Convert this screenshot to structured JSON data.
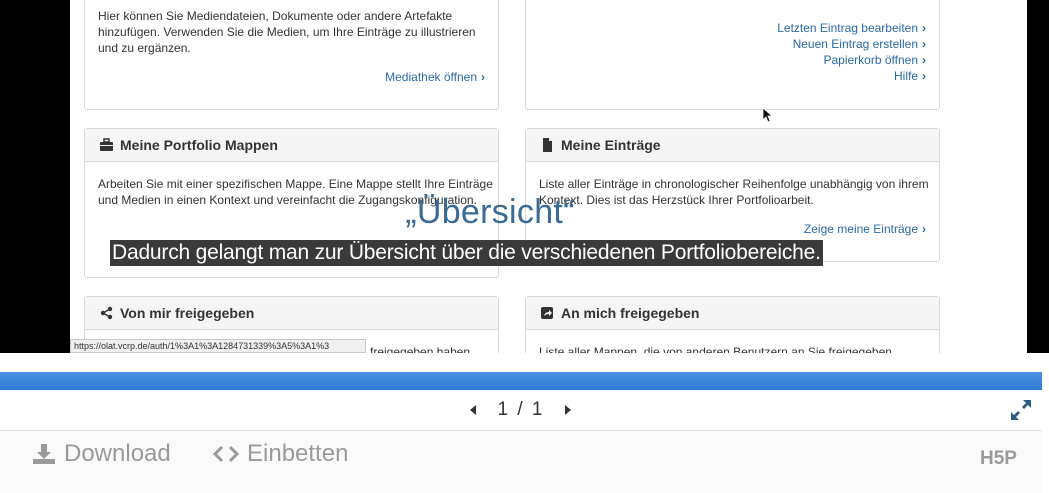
{
  "slide": {
    "media_panel": {
      "text": "Hier können Sie Mediendateien, Dokumente oder andere Artefakte hinzufügen. Verwenden Sie die Medien, um Ihre Einträge zu illustrieren und zu ergänzen.",
      "link": "Mediathek öffnen"
    },
    "quick_links": [
      "Letzten Eintrag bearbeiten",
      "Neuen Eintrag erstellen",
      "Papierkorb öffnen",
      "Hilfe"
    ],
    "portfolio_panel": {
      "title": "Meine Portfolio Mappen",
      "text": "Arbeiten Sie mit einer spezifischen Mappe. Eine Mappe stellt Ihre Einträge und Medien in einen Kontext und vereinfacht die Zugangskonfiguration."
    },
    "entries_panel": {
      "title": "Meine Einträge",
      "text": "Liste aller Einträge in chronologischer Reihenfolge unabhängig von ihrem Kontext. Dies ist das Herzstück Ihrer Portfolioarbeit.",
      "link": "Zeige meine Einträge"
    },
    "shared_by_me_panel": {
      "title": "Von mir freigegeben",
      "text_fragment": "freigegeben haben"
    },
    "shared_with_me_panel": {
      "title": "An mich freigegeben",
      "text": "Liste aller Mappen, die von anderen Benutzern an Sie freigegeben"
    },
    "status_url": "https://olat.vcrp.de/auth/1%3A1%3A1284731339%3A5%3A1%3",
    "overlay_title": "„Übersicht“",
    "overlay_subtitle": "Dadurch gelangt man zur Übersicht über die verschiedenen Portfoliobereiche."
  },
  "player": {
    "progress": 1.0,
    "page_counter": "1 / 1",
    "download_label": "Download",
    "embed_label": "Einbetten",
    "logo_text": "H5P"
  },
  "colors": {
    "accent": "#2f7ad6",
    "link": "#2a6aa6",
    "overlay_title": "#3a6a96"
  },
  "icons": [
    "briefcase-icon",
    "file-icon",
    "share-icon",
    "share-square-icon",
    "chevron-right-icon",
    "caret-left-icon",
    "caret-right-icon",
    "expand-icon",
    "download-icon",
    "code-icon",
    "cursor-icon"
  ]
}
